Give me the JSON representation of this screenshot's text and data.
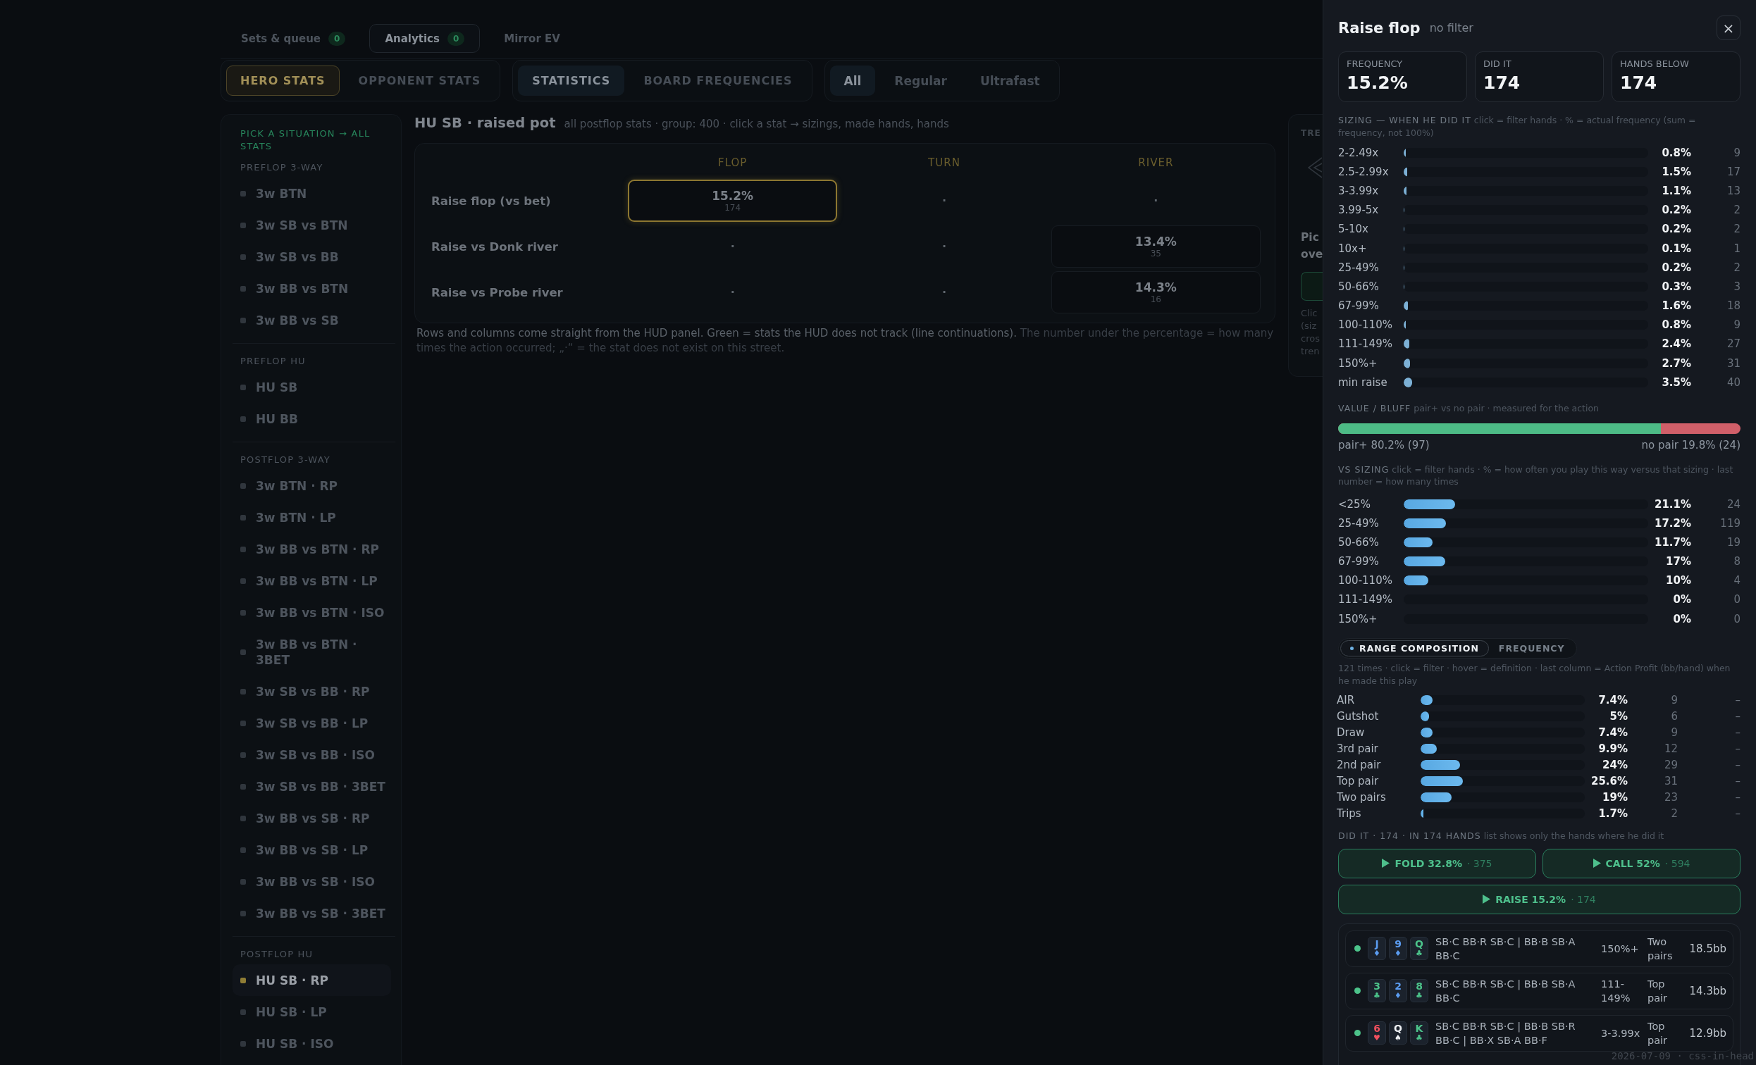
{
  "top_tabs": [
    {
      "label": "Sets & queue",
      "badge": "0",
      "selected": false
    },
    {
      "label": "Analytics",
      "badge": "0",
      "selected": true
    },
    {
      "label": "Mirror EV",
      "selected": false
    }
  ],
  "filter_groups": [
    {
      "kind": "perspective",
      "options": [
        {
          "label": "HERO STATS",
          "selected": true
        },
        {
          "label": "OPPONENT STATS",
          "selected": false
        }
      ]
    },
    {
      "kind": "view",
      "options": [
        {
          "label": "STATISTICS",
          "selected": true
        },
        {
          "label": "BOARD FREQUENCIES",
          "selected": false
        }
      ]
    },
    {
      "kind": "game_type",
      "options": [
        {
          "label": "All",
          "selected": true
        },
        {
          "label": "Regular",
          "selected": false
        },
        {
          "label": "Ultrafast",
          "selected": false
        }
      ]
    }
  ],
  "sidebar": {
    "heading": "PICK A SITUATION → ALL STATS",
    "sections": [
      {
        "title": "PREFLOP 3-WAY",
        "items": [
          {
            "label": "3w BTN",
            "selected": false
          },
          {
            "label": "3w SB vs BTN",
            "selected": false
          },
          {
            "label": "3w SB vs BB",
            "selected": false
          },
          {
            "label": "3w BB vs BTN",
            "selected": false
          },
          {
            "label": "3w BB vs SB",
            "selected": false
          }
        ]
      },
      {
        "title": "PREFLOP HU",
        "items": [
          {
            "label": "HU SB",
            "selected": false
          },
          {
            "label": "HU BB",
            "selected": false
          }
        ]
      },
      {
        "title": "POSTFLOP 3-WAY",
        "items": [
          {
            "label": "3w BTN · RP",
            "selected": false
          },
          {
            "label": "3w BTN · LP",
            "selected": false
          },
          {
            "label": "3w BB vs BTN · RP",
            "selected": false
          },
          {
            "label": "3w BB vs BTN · LP",
            "selected": false
          },
          {
            "label": "3w BB vs BTN · ISO",
            "selected": false
          },
          {
            "label": "3w BB vs BTN · 3BET",
            "selected": false
          },
          {
            "label": "3w SB vs BB · RP",
            "selected": false
          },
          {
            "label": "3w SB vs BB · LP",
            "selected": false
          },
          {
            "label": "3w SB vs BB · ISO",
            "selected": false
          },
          {
            "label": "3w SB vs BB · 3BET",
            "selected": false
          },
          {
            "label": "3w BB vs SB · RP",
            "selected": false
          },
          {
            "label": "3w BB vs SB · LP",
            "selected": false
          },
          {
            "label": "3w BB vs SB · ISO",
            "selected": false
          },
          {
            "label": "3w BB vs SB · 3BET",
            "selected": false
          }
        ]
      },
      {
        "title": "POSTFLOP HU",
        "items": [
          {
            "label": "HU SB · RP",
            "selected": true
          },
          {
            "label": "HU SB · LP",
            "selected": false
          },
          {
            "label": "HU SB · ISO",
            "selected": false
          }
        ]
      }
    ]
  },
  "report": {
    "title": "HU SB · raised pot",
    "subtitle": "all postflop stats · group: 400 · click a stat → sizings, made hands, hands",
    "table": {
      "columns": [
        "FLOP",
        "TURN",
        "RIVER"
      ],
      "rows": [
        {
          "label": "Raise flop (vs bet)",
          "cells": [
            {
              "kind": "stat",
              "value": "15.2%",
              "count": "174",
              "selected": true
            },
            {
              "kind": "empty",
              "mark": "·"
            },
            {
              "kind": "empty",
              "mark": "·"
            }
          ]
        },
        {
          "label": "Raise vs Donk river",
          "cells": [
            {
              "kind": "empty",
              "mark": "·"
            },
            {
              "kind": "empty",
              "mark": "·"
            },
            {
              "kind": "stat",
              "value": "13.4%",
              "count": "35",
              "selected": false
            }
          ]
        },
        {
          "label": "Raise vs Probe river",
          "cells": [
            {
              "kind": "empty",
              "mark": "·"
            },
            {
              "kind": "empty",
              "mark": "·"
            },
            {
              "kind": "stat",
              "value": "14.3%",
              "count": "16",
              "selected": false
            }
          ]
        }
      ]
    },
    "note": {
      "lead": "Rows and columns come straight from the HUD panel. Green = stats the HUD does not track (line continuations).",
      "rest": "The number under the percentage = how many times the action occurred; „·“ = the stat does not exist on this street."
    }
  },
  "side_card": {
    "heading": "TRE",
    "title": "Pic ove",
    "text": "Clic (siz cros tren"
  },
  "drawer": {
    "title": "Raise flop",
    "filter": "no filter",
    "close": "×",
    "stats": [
      {
        "label": "FREQUENCY",
        "value": "15.2%"
      },
      {
        "label": "DID IT",
        "value": "174"
      },
      {
        "label": "HANDS BELOW",
        "value": "174"
      }
    ],
    "sizing": {
      "heading": "SIZING — WHEN HE DID IT",
      "hint": "click = filter hands · % = actual frequency (sum = frequency, not 100%)",
      "rows": [
        {
          "label": "2-2.49x",
          "level": 0.008,
          "percent": "0.8%",
          "count": "9"
        },
        {
          "label": "2.5-2.99x",
          "level": 0.015,
          "percent": "1.5%",
          "count": "17"
        },
        {
          "label": "3-3.99x",
          "level": 0.011,
          "percent": "1.1%",
          "count": "13"
        },
        {
          "label": "3.99-5x",
          "level": 0.002,
          "percent": "0.2%",
          "count": "2"
        },
        {
          "label": "5-10x",
          "level": 0.002,
          "percent": "0.2%",
          "count": "2"
        },
        {
          "label": "10x+",
          "level": 0.001,
          "percent": "0.1%",
          "count": "1"
        },
        {
          "label": "25-49%",
          "level": 0.002,
          "percent": "0.2%",
          "count": "2"
        },
        {
          "label": "50-66%",
          "level": 0.003,
          "percent": "0.3%",
          "count": "3"
        },
        {
          "label": "67-99%",
          "level": 0.016,
          "percent": "1.6%",
          "count": "18"
        },
        {
          "label": "100-110%",
          "level": 0.008,
          "percent": "0.8%",
          "count": "9"
        },
        {
          "label": "111-149%",
          "level": 0.024,
          "percent": "2.4%",
          "count": "27"
        },
        {
          "label": "150%+",
          "level": 0.027,
          "percent": "2.7%",
          "count": "31"
        },
        {
          "label": "min raise",
          "level": 0.035,
          "percent": "3.5%",
          "count": "40"
        }
      ]
    },
    "value_bluff": {
      "heading": "VALUE / BLUFF",
      "hint": "pair+ vs no pair · measured for the action",
      "level": 0.802,
      "value_label": "pair+ 80.2% (97)",
      "bluff_label": "no pair 19.8% (24)"
    },
    "vs_sizing": {
      "heading": "VS SIZING",
      "hint": "click = filter hands · % = how often you play this way versus that sizing · last number = how many times",
      "rows": [
        {
          "label": "<25%",
          "level": 0.211,
          "percent": "21.1%",
          "count": "24"
        },
        {
          "label": "25-49%",
          "level": 0.172,
          "percent": "17.2%",
          "count": "119"
        },
        {
          "label": "50-66%",
          "level": 0.117,
          "percent": "11.7%",
          "count": "19"
        },
        {
          "label": "67-99%",
          "level": 0.17,
          "percent": "17%",
          "count": "8"
        },
        {
          "label": "100-110%",
          "level": 0.1,
          "percent": "10%",
          "count": "4"
        },
        {
          "label": "111-149%",
          "percent": "0%",
          "count": "0"
        },
        {
          "label": "150%+",
          "percent": "0%",
          "count": "0"
        }
      ]
    },
    "composition": {
      "tabs": [
        {
          "label": "RANGE COMPOSITION",
          "selected": true
        },
        {
          "label": "FREQUENCY",
          "selected": false
        }
      ],
      "hint": "121 times · click = filter · hover = definition · last column = Action Profit (bb/hand) when he made this play",
      "rows": [
        {
          "label": "AIR",
          "level": 0.074,
          "percent": "7.4%",
          "count": "9",
          "profit": "–"
        },
        {
          "label": "Gutshot",
          "level": 0.05,
          "percent": "5%",
          "count": "6",
          "profit": "–"
        },
        {
          "label": "Draw",
          "level": 0.074,
          "percent": "7.4%",
          "count": "9",
          "profit": "–"
        },
        {
          "label": "3rd pair",
          "level": 0.099,
          "percent": "9.9%",
          "count": "12",
          "profit": "–"
        },
        {
          "label": "2nd pair",
          "level": 0.24,
          "percent": "24%",
          "count": "29",
          "profit": "–"
        },
        {
          "label": "Top pair",
          "level": 0.256,
          "percent": "25.6%",
          "count": "31",
          "profit": "–"
        },
        {
          "label": "Two pairs",
          "level": 0.19,
          "percent": "19%",
          "count": "23",
          "profit": "–"
        },
        {
          "label": "Trips",
          "level": 0.017,
          "percent": "1.7%",
          "count": "2",
          "profit": "–"
        }
      ]
    },
    "did_it": {
      "heading": "DID IT · 174 · IN 174 HANDS",
      "hint": "list shows only the hands where he did it"
    },
    "actions": [
      {
        "label": "FOLD 32.8%",
        "count": "· 375"
      },
      {
        "label": "CALL 52%",
        "count": "· 594"
      },
      {
        "label": "RAISE 15.2%",
        "count": "· 174"
      }
    ],
    "hands": [
      {
        "color": "#4cc38a",
        "cards": [
          {
            "rank": "J",
            "suit": "♦",
            "color": "#5b9cf0"
          },
          {
            "rank": "9",
            "suit": "♦",
            "color": "#5b9cf0"
          },
          {
            "rank": "Q",
            "suit": "♣",
            "color": "#4cc38a"
          }
        ],
        "line": "SB·C BB·R SB·C | BB·B SB·A BB·C",
        "sizing": "150%+",
        "made": "Two pairs",
        "result": "18.5bb"
      },
      {
        "color": "#4cc38a",
        "cards": [
          {
            "rank": "3",
            "suit": "♣",
            "color": "#4cc38a"
          },
          {
            "rank": "2",
            "suit": "♦",
            "color": "#5b9cf0"
          },
          {
            "rank": "8",
            "suit": "♣",
            "color": "#4cc38a"
          }
        ],
        "line": "SB·C BB·R SB·C | BB·B SB·A BB·C",
        "sizing": "111-149%",
        "made": "Top pair",
        "result": "14.3bb"
      },
      {
        "color": "#4cc38a",
        "cards": [
          {
            "rank": "6",
            "suit": "♥",
            "color": "#f0505e"
          },
          {
            "rank": "Q",
            "suit": "♠",
            "color": "#eef1f4"
          },
          {
            "rank": "K",
            "suit": "♣",
            "color": "#4cc38a"
          }
        ],
        "line": "SB·C BB·R SB·C | BB·B SB·R BB·C | BB·X SB·A BB·F",
        "sizing": "3-3.99x",
        "made": "Top pair",
        "result": "12.9bb"
      }
    ]
  },
  "footer_stamp": "2026-07-09 · css-in-head"
}
